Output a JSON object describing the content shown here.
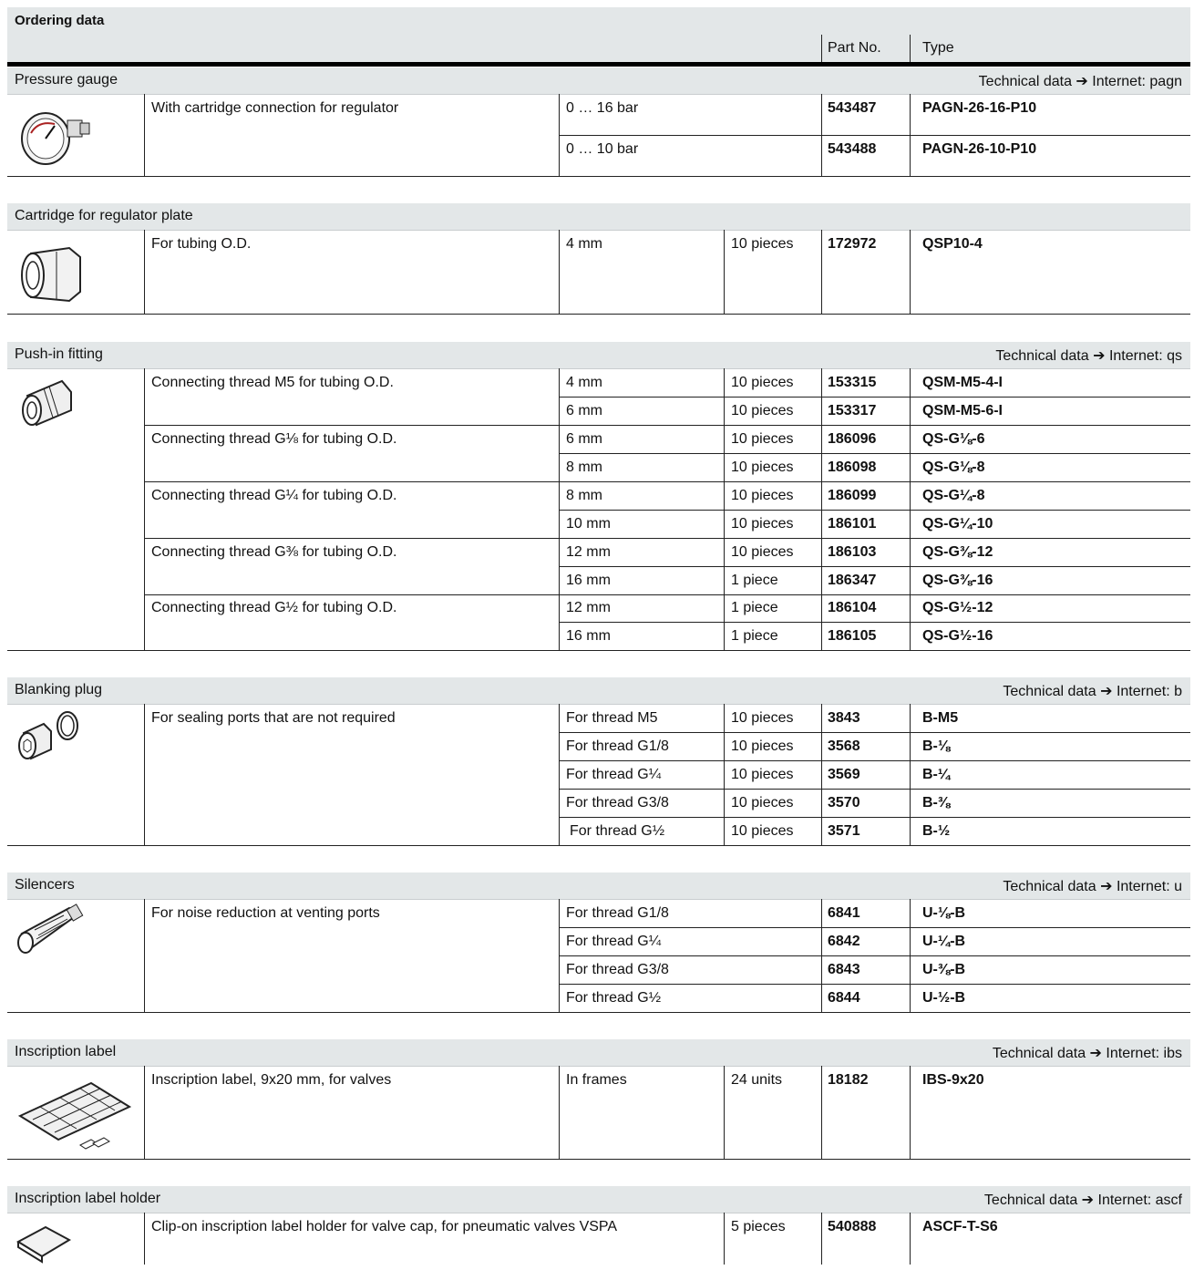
{
  "title": "Ordering data",
  "header": {
    "part_no": "Part No.",
    "type": "Type"
  },
  "sections": {
    "pressure_gauge": {
      "name": "Pressure gauge",
      "tech": "Technical data ➔ Internet: pagn",
      "desc": "With cartridge connection for regulator",
      "rows": [
        {
          "spec": "0 … 16 bar",
          "qty": "",
          "part": "543487",
          "type": "PAGN-26-16-P10"
        },
        {
          "spec": "0 … 10 bar",
          "qty": "",
          "part": "543488",
          "type": "PAGN-26-10-P10"
        }
      ]
    },
    "cartridge": {
      "name": "Cartridge for regulator plate",
      "desc": "For tubing O.D.",
      "rows": [
        {
          "spec": "4 mm",
          "qty": "10 pieces",
          "part": "172972",
          "type": "QSP10-4"
        }
      ]
    },
    "push_in": {
      "name": "Push-in fitting",
      "tech": "Technical data ➔ Internet: qs",
      "descs": [
        "Connecting thread M5 for tubing O.D.",
        "Connecting thread G⅛ for tubing O.D.",
        "Connecting thread G¼ for tubing O.D.",
        "Connecting thread G⅜ for tubing O.D.",
        "Connecting thread G½ for tubing O.D."
      ],
      "rows": [
        {
          "spec": "4 mm",
          "qty": "10 pieces",
          "part": "153315",
          "type": "QSM-M5-4-I"
        },
        {
          "spec": "6 mm",
          "qty": "10 pieces",
          "part": "153317",
          "type": "QSM-M5-6-I"
        },
        {
          "spec": "6 mm",
          "qty": "10 pieces",
          "part": "186096",
          "type": "QS-G⅛-6"
        },
        {
          "spec": "8 mm",
          "qty": "10 pieces",
          "part": "186098",
          "type": "QS-G⅛-8"
        },
        {
          "spec": "8 mm",
          "qty": "10 pieces",
          "part": "186099",
          "type": "QS-G¼-8"
        },
        {
          "spec": "10 mm",
          "qty": "10 pieces",
          "part": "186101",
          "type": "QS-G¼-10"
        },
        {
          "spec": "12 mm",
          "qty": "10 pieces",
          "part": "186103",
          "type": "QS-G⅜-12"
        },
        {
          "spec": "16 mm",
          "qty": "1 piece",
          "part": "186347",
          "type": "QS-G⅜-16"
        },
        {
          "spec": "12 mm",
          "qty": "1 piece",
          "part": "186104",
          "type": "QS-G½-12"
        },
        {
          "spec": "16 mm",
          "qty": "1 piece",
          "part": "186105",
          "type": "QS-G½-16"
        }
      ]
    },
    "blanking": {
      "name": "Blanking plug",
      "tech": "Technical data ➔ Internet: b",
      "desc": "For sealing ports that are not required",
      "rows": [
        {
          "spec": "For thread M5",
          "qty": "10 pieces",
          "part": "3843",
          "type": "B-M5"
        },
        {
          "spec": "For thread G1/8",
          "qty": "10 pieces",
          "part": "3568",
          "type": "B-⅛"
        },
        {
          "spec": "For thread G¼",
          "qty": "10 pieces",
          "part": "3569",
          "type": "B-¼"
        },
        {
          "spec": "For thread G3/8",
          "qty": "10 pieces",
          "part": "3570",
          "type": "B-⅜"
        },
        {
          "spec": "For thread G½",
          "qty": "10 pieces",
          "part": "3571",
          "type": "B-½"
        }
      ]
    },
    "silencers": {
      "name": "Silencers",
      "tech": "Technical data ➔ Internet: u",
      "desc": "For noise reduction at venting ports",
      "rows": [
        {
          "spec": "For thread G1/8",
          "part": "6841",
          "type": "U-⅛-B"
        },
        {
          "spec": "For thread G¼",
          "part": "6842",
          "type": "U-¼-B"
        },
        {
          "spec": "For thread G3/8",
          "part": "6843",
          "type": "U-⅜-B"
        },
        {
          "spec": "For thread G½",
          "part": "6844",
          "type": "U-½-B"
        }
      ]
    },
    "label": {
      "name": "Inscription label",
      "tech": "Technical data ➔ Internet: ibs",
      "desc": "Inscription label, 9x20 mm, for valves",
      "rows": [
        {
          "spec": "In frames",
          "qty": "24 units",
          "part": "18182",
          "type": "IBS-9x20"
        }
      ]
    },
    "holder": {
      "name": "Inscription label holder",
      "tech": "Technical data ➔ Internet: ascf",
      "desc": "Clip-on inscription label holder for valve cap, for pneumatic valves VSPA",
      "rows": [
        {
          "qty": "5 pieces",
          "part": "540888",
          "type": "ASCF-T-S6"
        }
      ]
    }
  }
}
